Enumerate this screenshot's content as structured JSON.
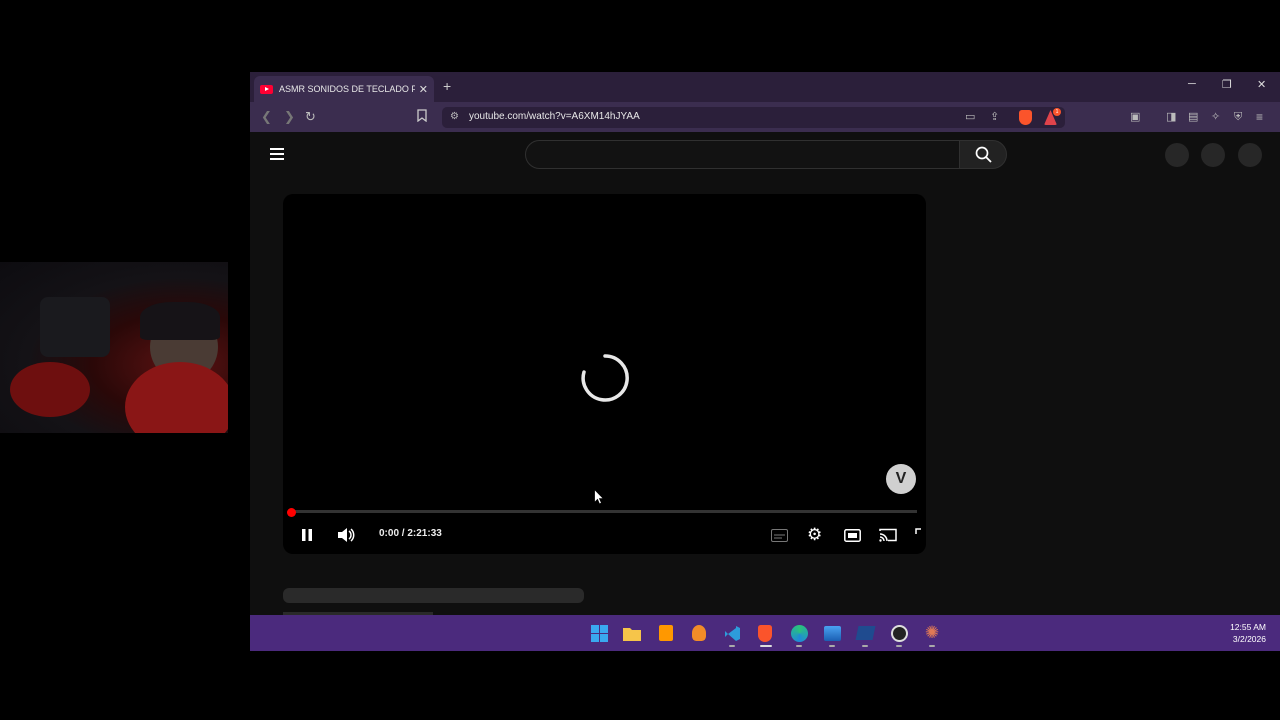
{
  "tab": {
    "title": "ASMR SONIDOS DE TECLADO PARA DORMIR",
    "close_symbol": "✕",
    "new_tab_symbol": "+"
  },
  "window_controls": {
    "minimize": "─",
    "restore": "❐",
    "close": "✕"
  },
  "address_bar": {
    "url": "youtube.com/watch?v=A6XM14hJYAA",
    "rewards_badge": "1"
  },
  "player": {
    "time_display": "0:00 / 2:21:33",
    "played_fraction": 0.0,
    "logo_letter": "V"
  },
  "taskbar": {
    "clock_time": "12:55 AM",
    "clock_date": "3/2/2026",
    "apps": [
      "windows-start",
      "file-explorer",
      "sublime-text",
      "fl-studio",
      "vscode",
      "brave",
      "edge",
      "photos",
      "powershell",
      "obs",
      "claude"
    ]
  },
  "colors": {
    "accent": "#ff0000",
    "titlebar": "#2b1f3a",
    "toolbar": "#3b2d4f",
    "taskbar": "#4b2a7d",
    "page_bg": "#0f0f0f"
  }
}
